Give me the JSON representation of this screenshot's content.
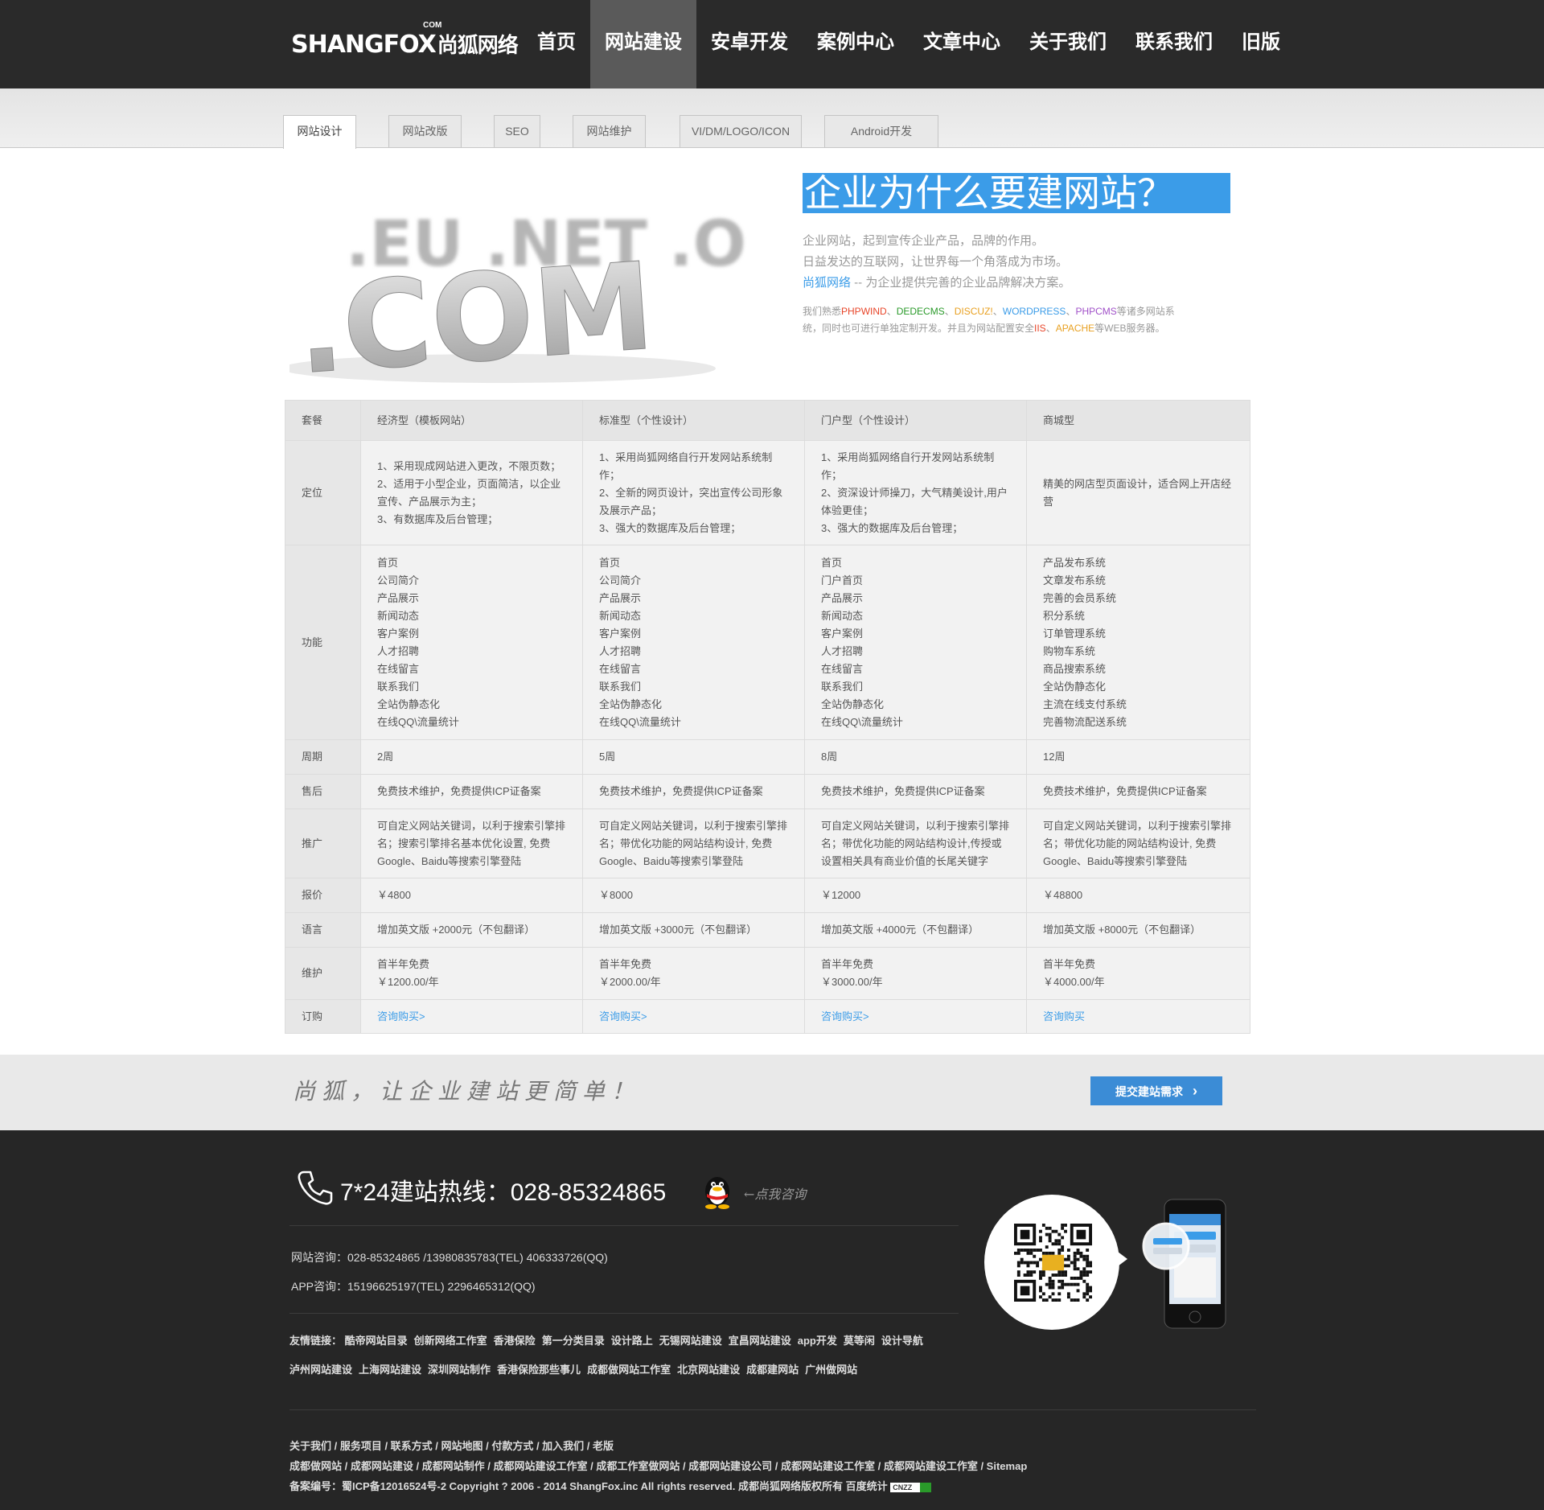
{
  "header": {
    "logo_text": "SHANGFOX",
    "logo_cn": "尚狐网络",
    "logo_com": "COM",
    "nav": [
      "首页",
      "网站建设",
      "安卓开发",
      "案例中心",
      "文章中心",
      "关于我们",
      "联系我们",
      "旧版"
    ],
    "active_nav": "网站建设"
  },
  "tabs": [
    "网站设计",
    "网站改版",
    "SEO",
    "网站维护",
    "VI/DM/LOGO/ICON",
    "Android开发"
  ],
  "active_tab": "网站设计",
  "hero": {
    "image_text_top": ".EU .NET .ORG",
    "image_text_main": ".COM",
    "title": "企业为什么要建网站？",
    "line1": "企业网站，起到宣传企业产品，品牌的作用。",
    "line2": "日益发达的互联网，让世界每一个角落成为市场。",
    "line3_brand": "尚狐网络",
    "line3_rest": " -- 为企业提供完善的企业品牌解决方案。",
    "small_prefix": "我们熟悉",
    "small_techs": [
      {
        "name": "PHPWIND",
        "color": "#e8462a"
      },
      {
        "name": "DEDECMS",
        "color": "#2a9a2a"
      },
      {
        "name": "DISCUZ!",
        "color": "#e8a020"
      },
      {
        "name": "WORDPRESS",
        "color": "#3b9ce8"
      },
      {
        "name": "PHPCMS",
        "color": "#a050c8"
      }
    ],
    "small_mid": "等诸多网站系统，同时也可进行单独定制开发。并且为网站配置安全",
    "small_iis": "IIS",
    "small_apache": "APACHE",
    "small_end": "等WEB服务器。"
  },
  "pricing": {
    "headers": [
      "套餐",
      "经济型（模板网站）",
      "标准型（个性设计）",
      "门户型（个性设计）",
      "商城型"
    ],
    "positioning_label": "定位",
    "positioning": [
      [
        "1、采用现成网站进入更改，不限页数；",
        "2、适用于小型企业，页面简洁，以企业宣传、产品展示为主；",
        "3、有数据库及后台管理；"
      ],
      [
        "1、采用尚狐网络自行开发网站系统制作；",
        "2、全新的网页设计，突出宣传公司形象及展示产品；",
        "3、强大的数据库及后台管理；"
      ],
      [
        "1、采用尚狐网络自行开发网站系统制作；",
        "2、资深设计师操刀，大气精美设计,用户体验更佳；",
        "3、强大的数据库及后台管理；"
      ],
      [
        "精美的网店型页面设计，适合网上开店经营"
      ]
    ],
    "features_label": "功能",
    "features": [
      [
        "首页",
        "公司简介",
        "产品展示",
        "新闻动态",
        "客户案例",
        "人才招聘",
        "在线留言",
        "联系我们",
        "全站伪静态化",
        "在线QQ\\流量统计"
      ],
      [
        "首页",
        "公司简介",
        "产品展示",
        "新闻动态",
        "客户案例",
        "人才招聘",
        "在线留言",
        "联系我们",
        "全站伪静态化",
        "在线QQ\\流量统计"
      ],
      [
        "首页",
        "门户首页",
        "产品展示",
        "新闻动态",
        "客户案例",
        "人才招聘",
        "在线留言",
        "联系我们",
        "全站伪静态化",
        "在线QQ\\流量统计"
      ],
      [
        "产品发布系统",
        "文章发布系统",
        "完善的会员系统",
        "积分系统",
        "订单管理系统",
        "购物车系统",
        "商品搜索系统",
        "全站伪静态化",
        "主流在线支付系统",
        "完善物流配送系统"
      ]
    ],
    "period_label": "周期",
    "period": [
      "2周",
      "5周",
      "8周",
      "12周"
    ],
    "aftersale_label": "售后",
    "aftersale": [
      "免费技术维护，免费提供ICP证备案",
      "免费技术维护，免费提供ICP证备案",
      "免费技术维护，免费提供ICP证备案",
      "免费技术维护，免费提供ICP证备案"
    ],
    "promo_label": "推广",
    "promo": [
      "可自定义网站关键词，以利于搜索引擎排名；搜索引擎排名基本优化设置, 免费Google、Baidu等搜索引擎登陆",
      "可自定义网站关键词，以利于搜索引擎排名；带优化功能的网站结构设计, 免费Google、Baidu等搜索引擎登陆",
      "可自定义网站关键词，以利于搜索引擎排名；带优化功能的网站结构设计,传授或设置相关具有商业价值的长尾关键字",
      "可自定义网站关键词，以利于搜索引擎排名；带优化功能的网站结构设计, 免费Google、Baidu等搜索引擎登陆"
    ],
    "price_label": "报价",
    "price": [
      "￥4800",
      "￥8000",
      "￥12000",
      "￥48800"
    ],
    "lang_label": "语言",
    "lang": [
      "增加英文版 +2000元（不包翻译）",
      "增加英文版 +3000元（不包翻译）",
      "增加英文版 +4000元（不包翻译）",
      "增加英文版 +8000元（不包翻译）"
    ],
    "maint_label": "维护",
    "maint_line1": [
      "首半年免费",
      "首半年免费",
      "首半年免费",
      "首半年免费"
    ],
    "maint_line2": [
      "￥1200.00/年",
      "￥2000.00/年",
      "￥3000.00/年",
      "￥4000.00/年"
    ],
    "order_label": "订购",
    "order": [
      "咨询购买>",
      "咨询购买>",
      "咨询购买>",
      "咨询购买"
    ]
  },
  "slogan": {
    "text": "尚狐，让企业建站更简单！",
    "button": "提交建站需求"
  },
  "footer": {
    "hotline_label": "7*24建站热线：",
    "hotline_number": "028-85324865",
    "qq_hint": "←点我咨询",
    "site_contact": "网站咨询：028-85324865 /13980835783(TEL) 406333726(QQ)",
    "app_contact": "APP咨询：15196625197(TEL) 2296465312(QQ)",
    "links_label": "友情链接：",
    "links": [
      "酷帝网站目录",
      "创新网络工作室",
      "香港保险",
      "第一分类目录",
      "设计路上",
      "无锡网站建设",
      "宜昌网站建设",
      "app开发",
      "莫等闲",
      "设计导航",
      "泸州网站建设",
      "上海网站建设",
      "深圳网站制作",
      "香港保险那些事儿",
      "成都做网站工作室",
      "北京网站建设",
      "成都建网站",
      "广州做网站"
    ],
    "bottom_line1": "关于我们 / 服务项目 / 联系方式 / 网站地图 / 付款方式 / 加入我们 / 老版",
    "bottom_line2": "成都做网站 / 成都网站建设 / 成都网站制作 / 成都网站建设工作室 / 成都工作室做网站 / 成都网站建设公司 / 成都网站建设工作室 / 成都网站建设工作室 / Sitemap",
    "bottom_line3": "备案编号：蜀ICP备12016524号-2 Copyright ? 2006 - 2014 ShangFox.inc All rights reserved. 成都尚狐网络版权所有 百度统计",
    "cnzz": "CNZZ"
  }
}
